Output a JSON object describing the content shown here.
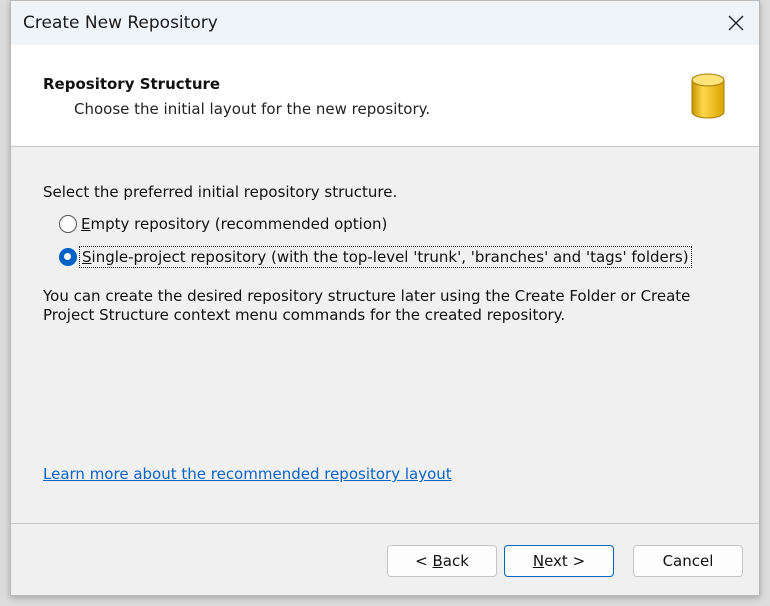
{
  "window": {
    "title": "Create New Repository"
  },
  "header": {
    "title": "Repository Structure",
    "subtitle": "Choose the initial layout for the new repository."
  },
  "main": {
    "prompt": "Select the preferred initial repository structure.",
    "options": [
      {
        "mnemonic": "E",
        "rest": "mpty repository (recommended option)",
        "selected": false
      },
      {
        "mnemonic": "S",
        "rest": "ingle-project repository (with the top-level 'trunk', 'branches' and 'tags' folders)",
        "selected": true
      }
    ],
    "info": "You can create the desired repository structure later using the Create Folder or Create Project Structure context menu commands for the created repository.",
    "link": "Learn more about the recommended repository layout"
  },
  "buttons": {
    "back_prefix": "< ",
    "back_mnemonic": "B",
    "back_rest": "ack",
    "next_mnemonic": "N",
    "next_rest": "ext >",
    "cancel": "Cancel"
  },
  "colors": {
    "accent": "#0062c4",
    "link": "#0b63c5",
    "cylinder": "#e8b400"
  },
  "icons": {
    "close": "close-icon",
    "header": "database-cylinder-icon"
  }
}
